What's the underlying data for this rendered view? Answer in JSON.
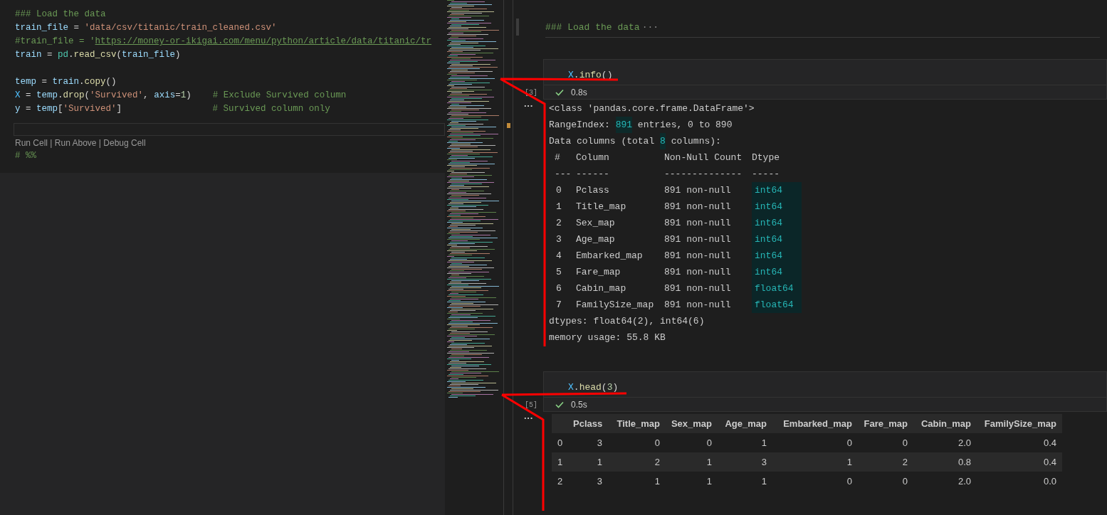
{
  "editor": {
    "blocks": [
      [
        [
          {
            "kind": "comment",
            "t": "### Load the data"
          }
        ],
        [
          {
            "kind": "var",
            "t": "train_file"
          },
          {
            "kind": "plain",
            "t": " = "
          },
          {
            "kind": "string",
            "t": "'data/csv/titanic/train_cleaned.csv'"
          }
        ],
        [
          {
            "kind": "comment",
            "t": "#train_file = '"
          },
          {
            "kind": "link",
            "t": "https://money-or-ikigai.com/menu/python/article/data/titanic/tr"
          }
        ],
        [
          {
            "kind": "var",
            "t": "train"
          },
          {
            "kind": "plain",
            "t": " = "
          },
          {
            "kind": "module",
            "t": "pd"
          },
          {
            "kind": "plain",
            "t": "."
          },
          {
            "kind": "func",
            "t": "read_csv"
          },
          {
            "kind": "plain",
            "t": "("
          },
          {
            "kind": "var",
            "t": "train_file"
          },
          {
            "kind": "plain",
            "t": ")"
          }
        ]
      ],
      [
        [
          {
            "kind": "var",
            "t": "temp"
          },
          {
            "kind": "plain",
            "t": " = "
          },
          {
            "kind": "var",
            "t": "train"
          },
          {
            "kind": "plain",
            "t": "."
          },
          {
            "kind": "func",
            "t": "copy"
          },
          {
            "kind": "plain",
            "t": "()"
          }
        ],
        [
          {
            "kind": "const",
            "t": "X"
          },
          {
            "kind": "plain",
            "t": " = "
          },
          {
            "kind": "var",
            "t": "temp"
          },
          {
            "kind": "plain",
            "t": "."
          },
          {
            "kind": "func",
            "t": "drop"
          },
          {
            "kind": "plain",
            "t": "("
          },
          {
            "kind": "string",
            "t": "'Survived'"
          },
          {
            "kind": "plain",
            "t": ", "
          },
          {
            "kind": "var",
            "t": "axis"
          },
          {
            "kind": "plain",
            "t": "="
          },
          {
            "kind": "number",
            "t": "1"
          },
          {
            "kind": "plain",
            "t": ")    "
          },
          {
            "kind": "comment",
            "t": "# Exclude Survived column"
          }
        ],
        [
          {
            "kind": "var",
            "t": "y"
          },
          {
            "kind": "plain",
            "t": " = "
          },
          {
            "kind": "var",
            "t": "temp"
          },
          {
            "kind": "plain",
            "t": "["
          },
          {
            "kind": "string",
            "t": "'Survived'"
          },
          {
            "kind": "plain",
            "t": "]                 "
          },
          {
            "kind": "comment",
            "t": "# Survived column only"
          }
        ]
      ]
    ],
    "codelens": "Run Cell | Run Above | Debug Cell",
    "after_lines": [
      [
        {
          "kind": "comment",
          "t": "# %%"
        }
      ]
    ]
  },
  "notebook": {
    "markdown_cell": {
      "text": "### Load the data",
      "fold_marker": "···"
    },
    "cells": [
      {
        "code": [
          {
            "kind": "const",
            "t": "X"
          },
          {
            "kind": "plain",
            "t": "."
          },
          {
            "kind": "func",
            "t": "info"
          },
          {
            "kind": "plain",
            "t": "()"
          }
        ],
        "exec_count": "[3]",
        "succeeded": true,
        "time": "0.8s",
        "output_prompt": "···",
        "output": {
          "kind": "info",
          "lines_before": [
            [
              {
                "t": "<class 'pandas.core.frame.DataFrame'>",
                "highlight": false
              }
            ],
            [
              {
                "t": "RangeIndex: ",
                "highlight": false
              },
              {
                "t": "891",
                "highlight": true
              },
              {
                "t": " entries, 0 to 890",
                "highlight": false
              }
            ],
            [
              {
                "t": "Data columns (total ",
                "highlight": false
              },
              {
                "t": "8",
                "highlight": true
              },
              {
                "t": " columns):",
                "highlight": false
              }
            ]
          ],
          "header": [
            "#",
            "Column",
            "Non-Null Count",
            "Dtype"
          ],
          "rule": [
            "---",
            "------",
            "--------------",
            "-----"
          ],
          "rows": [
            [
              "0",
              "Pclass",
              "891 non-null",
              "int64"
            ],
            [
              "1",
              "Title_map",
              "891 non-null",
              "int64"
            ],
            [
              "2",
              "Sex_map",
              "891 non-null",
              "int64"
            ],
            [
              "3",
              "Age_map",
              "891 non-null",
              "int64"
            ],
            [
              "4",
              "Embarked_map",
              "891 non-null",
              "int64"
            ],
            [
              "5",
              "Fare_map",
              "891 non-null",
              "int64"
            ],
            [
              "6",
              "Cabin_map",
              "891 non-null",
              "float64"
            ],
            [
              "7",
              "FamilySize_map",
              "891 non-null",
              "float64"
            ]
          ],
          "lines_after": [
            "dtypes: float64(2), int64(6)",
            "memory usage: 55.8 KB"
          ]
        }
      },
      {
        "code": [
          {
            "kind": "const",
            "t": "X"
          },
          {
            "kind": "plain",
            "t": "."
          },
          {
            "kind": "func",
            "t": "head"
          },
          {
            "kind": "plain",
            "t": "("
          },
          {
            "kind": "number",
            "t": "3"
          },
          {
            "kind": "plain",
            "t": ")"
          }
        ],
        "exec_count": "[5]",
        "succeeded": true,
        "time": "0.5s",
        "output_prompt": "···",
        "output": {
          "kind": "table",
          "columns": [
            "Pclass",
            "Title_map",
            "Sex_map",
            "Age_map",
            "Embarked_map",
            "Fare_map",
            "Cabin_map",
            "FamilySize_map"
          ],
          "rows": [
            {
              "index": "0",
              "values": [
                "3",
                "0",
                "0",
                "1",
                "0",
                "0",
                "2.0",
                "0.4"
              ]
            },
            {
              "index": "1",
              "values": [
                "1",
                "2",
                "1",
                "3",
                "1",
                "2",
                "0.8",
                "0.4"
              ]
            },
            {
              "index": "2",
              "values": [
                "3",
                "1",
                "1",
                "1",
                "0",
                "0",
                "2.0",
                "0.0"
              ]
            }
          ]
        }
      }
    ]
  }
}
